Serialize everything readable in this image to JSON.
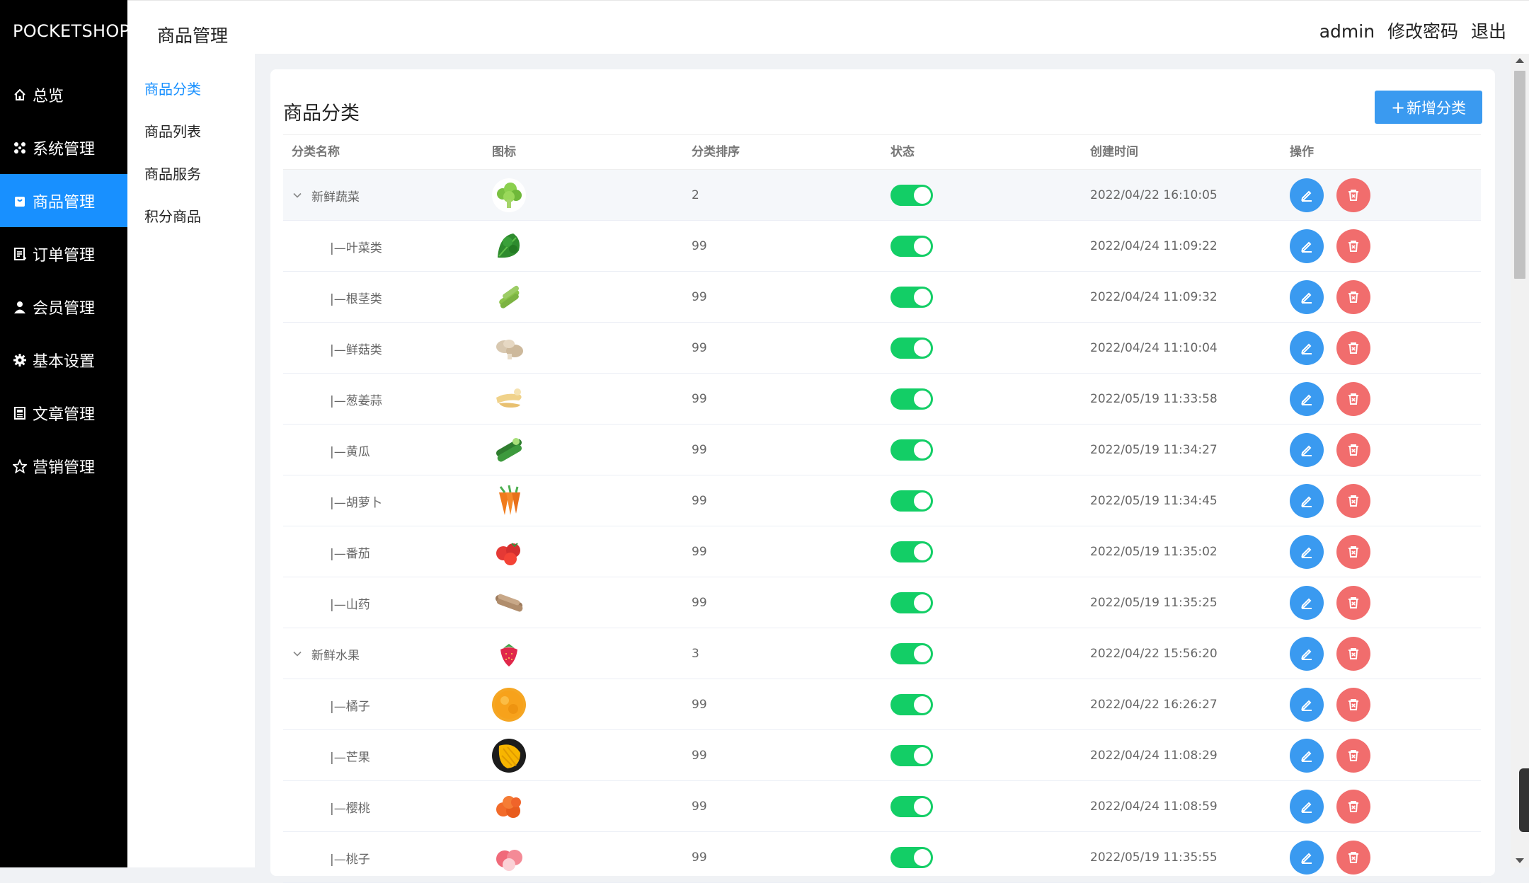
{
  "app": {
    "logo": "POCKETSHOP"
  },
  "sidebar": {
    "items": [
      {
        "label": "总览",
        "icon": "home-icon",
        "active": false
      },
      {
        "label": "系统管理",
        "icon": "system-icon",
        "active": false
      },
      {
        "label": "商品管理",
        "icon": "bag-icon",
        "active": true
      },
      {
        "label": "订单管理",
        "icon": "order-icon",
        "active": false
      },
      {
        "label": "会员管理",
        "icon": "user-icon",
        "active": false
      },
      {
        "label": "基本设置",
        "icon": "gear-icon",
        "active": false
      },
      {
        "label": "文章管理",
        "icon": "article-icon",
        "active": false
      },
      {
        "label": "营销管理",
        "icon": "star-icon",
        "active": false
      }
    ]
  },
  "header": {
    "module_title": "商品管理",
    "user": "admin",
    "change_password": "修改密码",
    "logout": "退出"
  },
  "submenu": {
    "items": [
      {
        "label": "商品分类",
        "active": true
      },
      {
        "label": "商品列表",
        "active": false
      },
      {
        "label": "商品服务",
        "active": false
      },
      {
        "label": "积分商品",
        "active": false
      }
    ]
  },
  "card": {
    "title": "商品分类",
    "add_button": "新增分类",
    "add_button_plus": "+"
  },
  "table": {
    "columns": [
      "分类名称",
      "图标",
      "分类排序",
      "状态",
      "创建时间",
      "操作"
    ],
    "rows": [
      {
        "name": "新鲜蔬菜",
        "parent": true,
        "sort": "2",
        "status": true,
        "created": "2022/04/22 16:10:05",
        "icon": "broccoli"
      },
      {
        "name": "|—叶菜类",
        "parent": false,
        "sort": "99",
        "status": true,
        "created": "2022/04/24 11:09:22",
        "icon": "leafy-greens"
      },
      {
        "name": "|—根茎类",
        "parent": false,
        "sort": "99",
        "status": true,
        "created": "2022/04/24 11:09:32",
        "icon": "celery"
      },
      {
        "name": "|—鲜菇类",
        "parent": false,
        "sort": "99",
        "status": true,
        "created": "2022/04/24 11:10:04",
        "icon": "mushroom"
      },
      {
        "name": "|—葱姜蒜",
        "parent": false,
        "sort": "99",
        "status": true,
        "created": "2022/05/19 11:33:58",
        "icon": "ginger"
      },
      {
        "name": "|—黄瓜",
        "parent": false,
        "sort": "99",
        "status": true,
        "created": "2022/05/19 11:34:27",
        "icon": "cucumber"
      },
      {
        "name": "|—胡萝卜",
        "parent": false,
        "sort": "99",
        "status": true,
        "created": "2022/05/19 11:34:45",
        "icon": "carrot"
      },
      {
        "name": "|—番茄",
        "parent": false,
        "sort": "99",
        "status": true,
        "created": "2022/05/19 11:35:02",
        "icon": "tomato"
      },
      {
        "name": "|—山药",
        "parent": false,
        "sort": "99",
        "status": true,
        "created": "2022/05/19 11:35:25",
        "icon": "yam"
      },
      {
        "name": "新鲜水果",
        "parent": true,
        "sort": "3",
        "status": true,
        "created": "2022/04/22 15:56:20",
        "icon": "strawberry"
      },
      {
        "name": "|—橘子",
        "parent": false,
        "sort": "99",
        "status": true,
        "created": "2022/04/22 16:26:27",
        "icon": "orange"
      },
      {
        "name": "|—芒果",
        "parent": false,
        "sort": "99",
        "status": true,
        "created": "2022/04/24 11:08:29",
        "icon": "mango"
      },
      {
        "name": "|—樱桃",
        "parent": false,
        "sort": "99",
        "status": true,
        "created": "2022/04/24 11:08:59",
        "icon": "cherry"
      },
      {
        "name": "|—桃子",
        "parent": false,
        "sort": "99",
        "status": true,
        "created": "2022/05/19 11:35:55",
        "icon": "peach"
      }
    ]
  },
  "colors": {
    "accent": "#1890ff",
    "button_blue": "#3a9af0",
    "switch_on": "#13ce66",
    "delete_red": "#f16d6d",
    "sidebar_bg": "#000000"
  }
}
